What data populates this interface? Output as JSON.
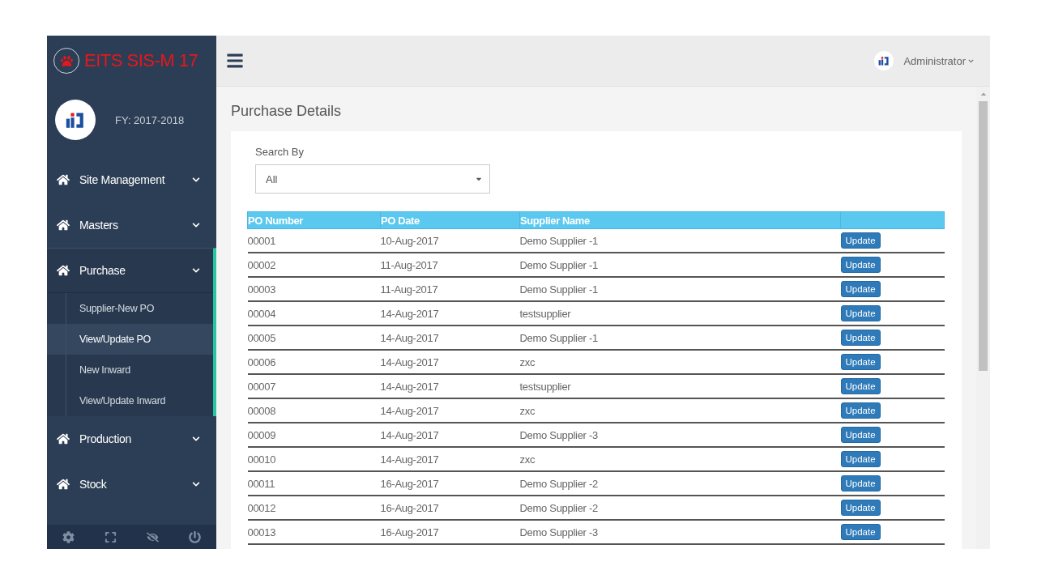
{
  "brand": {
    "title": "EITS SIS-M 17"
  },
  "profile": {
    "fy": "FY: 2017-2018"
  },
  "sidebar": {
    "items": [
      {
        "label": "Site Management",
        "expanded": false
      },
      {
        "label": "Masters",
        "expanded": false
      },
      {
        "label": "Purchase",
        "expanded": true,
        "children": [
          {
            "label": "Supplier-New PO",
            "selected": false
          },
          {
            "label": "View/Update PO",
            "selected": true
          },
          {
            "label": "New Inward",
            "selected": false
          },
          {
            "label": "View/Update Inward",
            "selected": false
          }
        ]
      },
      {
        "label": "Production",
        "expanded": false
      },
      {
        "label": "Stock",
        "expanded": false
      }
    ]
  },
  "topbar": {
    "user": "Administrator"
  },
  "page_title": "Purchase Details",
  "search": {
    "label": "Search By",
    "value": "All"
  },
  "table": {
    "columns": [
      "PO Number",
      "PO Date",
      "Supplier Name"
    ],
    "rows": [
      {
        "po_number": "00001",
        "po_date": "10-Aug-2017",
        "supplier": "Demo Supplier -1",
        "action": "Update"
      },
      {
        "po_number": "00002",
        "po_date": "11-Aug-2017",
        "supplier": "Demo Supplier -1",
        "action": "Update"
      },
      {
        "po_number": "00003",
        "po_date": "11-Aug-2017",
        "supplier": "Demo Supplier -1",
        "action": "Update"
      },
      {
        "po_number": "00004",
        "po_date": "14-Aug-2017",
        "supplier": "testsupplier",
        "action": "Update"
      },
      {
        "po_number": "00005",
        "po_date": "14-Aug-2017",
        "supplier": "Demo Supplier -1",
        "action": "Update"
      },
      {
        "po_number": "00006",
        "po_date": "14-Aug-2017",
        "supplier": "zxc",
        "action": "Update"
      },
      {
        "po_number": "00007",
        "po_date": "14-Aug-2017",
        "supplier": "testsupplier",
        "action": "Update"
      },
      {
        "po_number": "00008",
        "po_date": "14-Aug-2017",
        "supplier": "zxc",
        "action": "Update"
      },
      {
        "po_number": "00009",
        "po_date": "14-Aug-2017",
        "supplier": "Demo Supplier -3",
        "action": "Update"
      },
      {
        "po_number": "00010",
        "po_date": "14-Aug-2017",
        "supplier": "zxc",
        "action": "Update"
      },
      {
        "po_number": "00011",
        "po_date": "16-Aug-2017",
        "supplier": "Demo Supplier -2",
        "action": "Update"
      },
      {
        "po_number": "00012",
        "po_date": "16-Aug-2017",
        "supplier": "Demo Supplier -2",
        "action": "Update"
      },
      {
        "po_number": "00013",
        "po_date": "16-Aug-2017",
        "supplier": "Demo Supplier -3",
        "action": "Update"
      }
    ]
  }
}
